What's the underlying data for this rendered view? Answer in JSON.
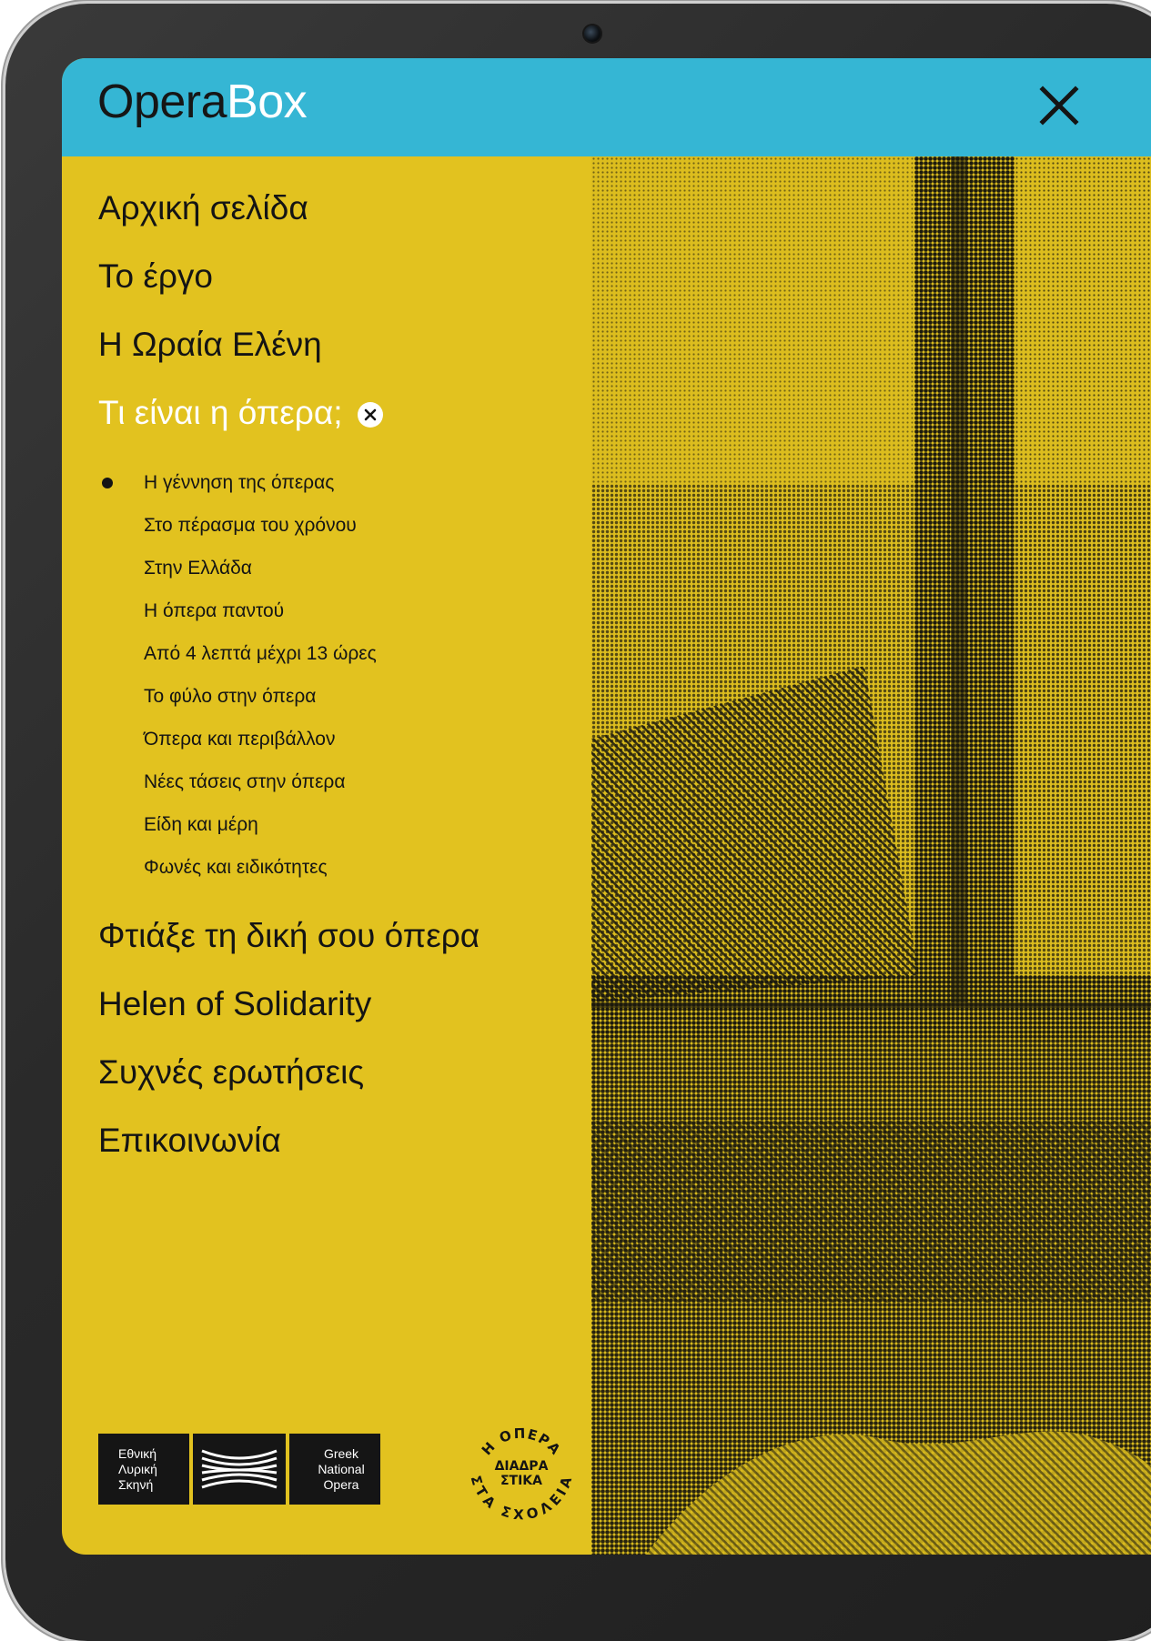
{
  "app": {
    "logo_part1": "Opera",
    "logo_part2": "Box"
  },
  "colors": {
    "header": "#35b6d4",
    "menu_bg": "#e2c21f",
    "text": "#141414",
    "active": "#ffffff"
  },
  "nav": {
    "top_items": [
      {
        "label": "Αρχική σελίδα"
      },
      {
        "label": "Το έργο"
      },
      {
        "label": "Η Ωραία Ελένη"
      }
    ],
    "active_item": {
      "label": "Τι είναι η όπερα;"
    },
    "sub_items": [
      {
        "label": "Η γέννηση της όπερας",
        "current": true
      },
      {
        "label": "Στο πέρασμα του χρόνου"
      },
      {
        "label": "Στην Ελλάδα"
      },
      {
        "label": "Η όπερα παντού"
      },
      {
        "label": "Από 4 λεπτά μέχρι 13 ώρες"
      },
      {
        "label": "Το φύλο στην όπερα"
      },
      {
        "label": "Όπερα και περιβάλλον"
      },
      {
        "label": "Νέες τάσεις στην όπερα"
      },
      {
        "label": "Είδη και μέρη"
      },
      {
        "label": "Φωνές και ειδικότητες"
      }
    ],
    "bottom_items": [
      {
        "label": "Φτιάξε τη δική σου όπερα"
      },
      {
        "label": "Helen of Solidarity"
      },
      {
        "label": "Συχνές ερωτήσεις"
      },
      {
        "label": "Επικοινωνία"
      }
    ]
  },
  "footer": {
    "gno_greek": [
      "Εθνική",
      "Λυρική",
      "Σκηνή"
    ],
    "gno_english": [
      "Greek",
      "National",
      "Opera"
    ],
    "seal_top": "Η ΟΠΕΡΑ",
    "seal_middle": [
      "ΔΙΑΔΡΑ",
      "ΣΤΙΚΑ"
    ],
    "seal_bottom": "ΣΤΑ ΣΧΟΛΕΙΑ"
  },
  "icons": {
    "close": "close-icon",
    "collapse": "close-circle-icon"
  }
}
